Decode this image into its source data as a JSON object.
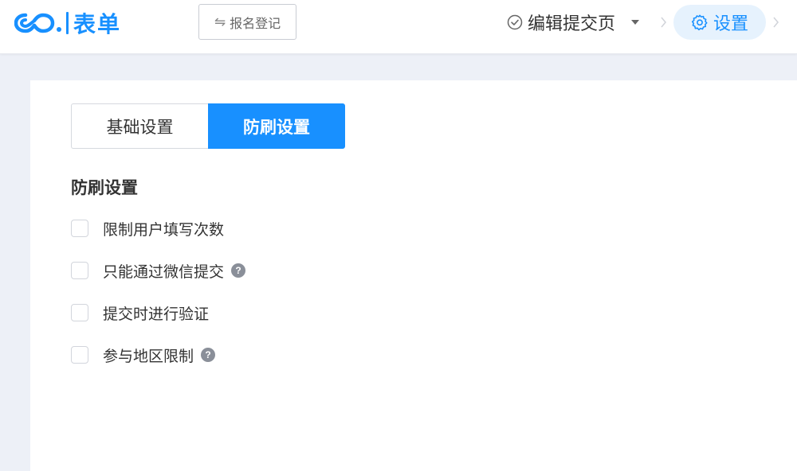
{
  "header": {
    "logo_text": "表单",
    "form_name_button": {
      "icon": "swap-arrows-icon",
      "label": "报名登记"
    },
    "steps": {
      "edit_page": {
        "icon": "check-circle-icon",
        "label": "编辑提交页"
      },
      "settings": {
        "icon": "gear-icon",
        "label": "设置"
      }
    }
  },
  "tabs": [
    {
      "label": "基础设置",
      "active": false
    },
    {
      "label": "防刷设置",
      "active": true
    }
  ],
  "section": {
    "title": "防刷设置",
    "options": [
      {
        "label": "限制用户填写次数",
        "checked": false,
        "help": false
      },
      {
        "label": "只能通过微信提交",
        "checked": false,
        "help": true
      },
      {
        "label": "提交时进行验证",
        "checked": false,
        "help": false
      },
      {
        "label": "参与地区限制",
        "checked": false,
        "help": true
      }
    ]
  },
  "colors": {
    "accent": "#1890ff",
    "page_bg": "#edf0f7",
    "settings_pill_bg": "#e6f2fd"
  }
}
